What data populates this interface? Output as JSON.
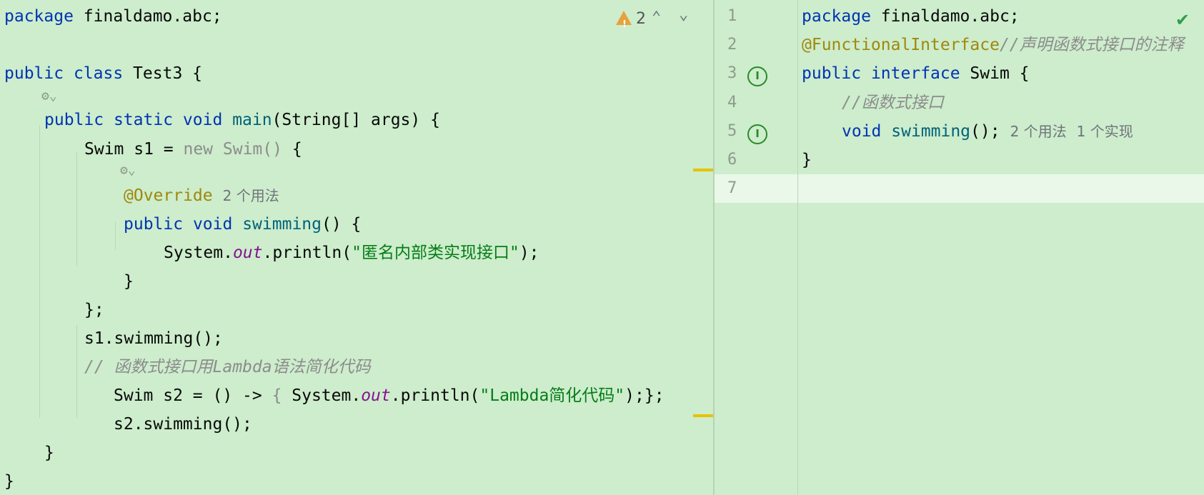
{
  "left_editor": {
    "warning_count": "2",
    "lines": {
      "l1_kw": "package",
      "l1_rest": " finaldamo.abc;",
      "l3_kw1": "public",
      "l3_kw2": "class",
      "l3_rest": " Test3 {",
      "l5_kw1": "public",
      "l5_kw2": "static",
      "l5_kw3": "void",
      "l5_fn": "main",
      "l5_rest": "(String[] args) {",
      "l6_a": "Swim s1 = ",
      "l6_b": "new Swim()",
      "l6_c": " {",
      "l8_ann": "@Override",
      "l8_hint": "2 个用法",
      "l9_kw1": "public",
      "l9_kw2": "void",
      "l9_fn": "swimming",
      "l9_rest": "() {",
      "l10_a": "System.",
      "l10_b": "out",
      "l10_c": ".println(",
      "l10_str": "\"匿名内部类实现接口\"",
      "l10_d": ");",
      "l11": "}",
      "l12": "};",
      "l13": "s1.swimming();",
      "l14_cmt": "// 函数式接口用Lambda语法简化代码",
      "l15_a": "Swim s2 = () -> ",
      "l15_brace": "{",
      "l15_b": " System.",
      "l15_out": "out",
      "l15_c": ".println(",
      "l15_str": "\"Lambda简化代码\"",
      "l15_d": ");};",
      "l16": "s2.swimming();",
      "l17": "}",
      "l18": "}"
    }
  },
  "right_editor": {
    "line_numbers": [
      "1",
      "2",
      "3",
      "4",
      "5",
      "6",
      "7"
    ],
    "lines": {
      "r1_kw": "package",
      "r1_rest": " finaldamo.abc;",
      "r2_ann": "@FunctionalInterface",
      "r2_cmt": "//声明函数式接口的注释",
      "r3_kw1": "public",
      "r3_kw2": "interface",
      "r3_rest": " Swim {",
      "r4_cmt": "//函数式接口",
      "r5_kw": "void",
      "r5_fn": "swimming",
      "r5_rest": "();",
      "r5_hint1": "2 个用法",
      "r5_hint2": "1 个实现",
      "r6": "}"
    }
  },
  "colors": {
    "background": "#cdedcc",
    "keyword": "#0033b3",
    "string": "#067d17",
    "annotation": "#9e880d",
    "comment": "#8c8c8c"
  },
  "icons": {
    "warning": "warning-triangle-icon",
    "nav_up": "chevron-up-icon",
    "nav_down": "chevron-down-icon",
    "gutter_run": "ai-gutter-icon",
    "implemented": "implemented-icon",
    "check": "checkmark-icon"
  }
}
